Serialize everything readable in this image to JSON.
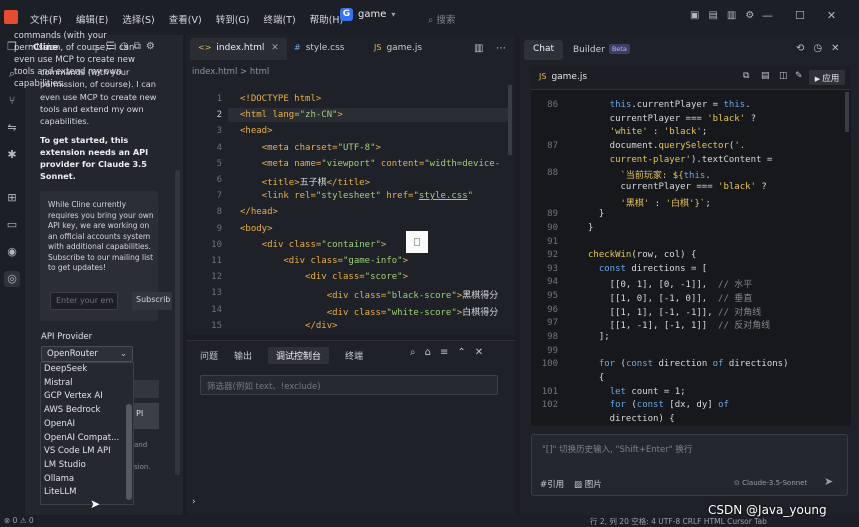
{
  "titlebar": {
    "menu": [
      "文件(F)",
      "编辑(E)",
      "选择(S)",
      "查看(V)",
      "转到(G)",
      "终端(T)",
      "帮助(H)"
    ],
    "project": "game",
    "project_icon": "G",
    "search_placeholder": "搜索"
  },
  "cline": {
    "title": "Cline",
    "intro": "commands (with your permission, of course). I can even use MCP to create new tools and extend my own capabilities.",
    "start": "To get started, this extension needs an API provider for Claude 3.5 Sonnet.",
    "info": "While Cline currently requires you bring your own API key, we are working on an official accounts system with additional capabilities. Subscribe to our mailing list to get updates!",
    "email_placeholder": "Enter your em",
    "subscribe": "Subscrib",
    "api_provider_label": "API Provider",
    "selected_provider": "OpenRouter",
    "providers": [
      "DeepSeek",
      "Mistral",
      "GCP Vertex AI",
      "AWS Bedrock",
      "OpenAI",
      "OpenAI Compat...",
      "VS Code LM API",
      "LM Studio",
      "Ollama",
      "LiteLLM"
    ],
    "behind_button": "PI",
    "behind_text_1": "and",
    "behind_text_2": "sion."
  },
  "editor": {
    "tabs": [
      {
        "label": "index.html",
        "icon": "<>"
      },
      {
        "label": "style.css",
        "icon": "#"
      },
      {
        "label": "game.js",
        "icon": "JS"
      }
    ],
    "breadcrumb": "index.html > html",
    "lines": [
      {
        "n": "1",
        "html": "<span class='tag'>&lt;!DOCTYPE html&gt;</span>"
      },
      {
        "n": "2",
        "html": "<span class='tag'>&lt;html</span> <span class='attr'>lang=</span><span class='str'>\"zh-CN\"</span><span class='tag'>&gt;</span>"
      },
      {
        "n": "3",
        "html": "<span class='tag'>&lt;head&gt;</span>"
      },
      {
        "n": "4",
        "html": "    <span class='tag'>&lt;meta</span> <span class='attr'>charset=</span><span class='str'>\"UTF-8\"</span><span class='tag'>&gt;</span>"
      },
      {
        "n": "5",
        "html": "    <span class='tag'>&lt;meta</span> <span class='attr'>name=</span><span class='str'>\"viewport\"</span> <span class='attr'>content=</span><span class='str'>\"width=device-</span>"
      },
      {
        "n": "6",
        "html": "    <span class='tag'>&lt;title&gt;</span><span class='txt'>五子棋</span><span class='tag'>&lt;/title&gt;</span>"
      },
      {
        "n": "7",
        "html": "    <span class='tag'>&lt;link</span> <span class='attr'>rel=</span><span class='str'>\"stylesheet\"</span> <span class='attr'>href=</span><span class='str'>\"<u>style.css</u>\"</span>"
      },
      {
        "n": "8",
        "html": "<span class='tag'>&lt;/head&gt;</span>"
      },
      {
        "n": "9",
        "html": "<span class='tag'>&lt;body&gt;</span>"
      },
      {
        "n": "10",
        "html": "    <span class='tag'>&lt;div</span> <span class='attr'>class=</span><span class='str'>\"container\"</span><span class='tag'>&gt;</span>"
      },
      {
        "n": "11",
        "html": "        <span class='tag'>&lt;div</span> <span class='attr'>class=</span><span class='str'>\"game-info\"</span><span class='tag'>&gt;</span>"
      },
      {
        "n": "12",
        "html": "            <span class='tag'>&lt;div</span> <span class='attr'>class=</span><span class='str'>\"score\"</span><span class='tag'>&gt;</span>"
      },
      {
        "n": "13",
        "html": "                <span class='tag'>&lt;div</span> <span class='attr'>class=</span><span class='str'>\"black-score\"</span><span class='tag'>&gt;</span><span class='txt'>黑棋得分</span>"
      },
      {
        "n": "14",
        "html": "                <span class='tag'>&lt;div</span> <span class='attr'>class=</span><span class='str'>\"white-score\"</span><span class='tag'>&gt;</span><span class='txt'>白棋得分</span>"
      },
      {
        "n": "15",
        "html": "            <span class='tag'>&lt;/div&gt;</span>"
      }
    ]
  },
  "panel": {
    "tabs": [
      "问题",
      "输出",
      "调试控制台",
      "终端"
    ],
    "active_tab": "调试控制台",
    "filter_placeholder": "筛选器(例如 text、!exclude)",
    "prompt": "›"
  },
  "chat": {
    "tabs": [
      "Chat",
      "Builder"
    ],
    "beta": "Beta",
    "file": "game.js",
    "apply": "应用",
    "lines": [
      {
        "n": "86",
        "html": "    <span class='kw'>this</span>.currentPlayer = <span class='kw'>this</span>."
      },
      {
        "n": "",
        "html": "    currentPlayer === <span class='rstr'>'black'</span> ?"
      },
      {
        "n": "",
        "html": "    <span class='rstr'>'white'</span> : <span class='rstr'>'black'</span>;"
      },
      {
        "n": "87",
        "html": "    document.<span class='fnm'>querySelector</span>(<span class='rstr'>'.</span>"
      },
      {
        "n": "",
        "html": "    <span class='rstr'>current-player'</span>).textContent ="
      },
      {
        "n": "88",
        "html": "      <span class='rstr'>`当前玩家: ${</span><span class='kw'>this</span>."
      },
      {
        "n": "",
        "html": "      currentPlayer === <span class='rstr'>'black'</span> ?"
      },
      {
        "n": "",
        "html": "      <span class='rstr'>'黑棋'</span> : <span class='rstr'>'白棋'</span><span class='rstr'>}`</span>;"
      },
      {
        "n": "89",
        "html": "  }"
      },
      {
        "n": "90",
        "html": "}"
      },
      {
        "n": "91",
        "html": ""
      },
      {
        "n": "92",
        "html": "<span class='fnm'>checkWin</span>(row, col) {"
      },
      {
        "n": "93",
        "html": "  <span class='kw'>const</span> directions = ["
      },
      {
        "n": "94",
        "html": "    [[0, 1], [0, -1]],  <span class='cm'>// 水平</span>"
      },
      {
        "n": "95",
        "html": "    [[1, 0], [-1, 0]],  <span class='cm'>// 垂直</span>"
      },
      {
        "n": "96",
        "html": "    [[1, 1], [-1, -1]], <span class='cm'>// 对角线</span>"
      },
      {
        "n": "97",
        "html": "    [[1, -1], [-1, 1]]  <span class='cm'>// 反对角线</span>"
      },
      {
        "n": "98",
        "html": "  ];"
      },
      {
        "n": "99",
        "html": ""
      },
      {
        "n": "100",
        "html": "  <span class='kw'>for</span> (<span class='kw'>const</span> direction <span class='kw'>of</span> directions)"
      },
      {
        "n": "",
        "html": "  {"
      },
      {
        "n": "101",
        "html": "    <span class='kw'>let</span> count = 1;"
      },
      {
        "n": "102",
        "html": "    <span class='kw'>for</span> (<span class='kw'>const</span> [dx, dy] <span class='kw'>of</span>"
      },
      {
        "n": "",
        "html": "    direction) {"
      }
    ],
    "input_placeholder": "\"[]\" 切换历史输入, \"Shift+Enter\" 换行",
    "ref_label": "#引用",
    "image_label": "图片",
    "model": "Claude-3.5-Sonnet"
  },
  "statusbar": {
    "left": "⊗ 0 ⚠ 0",
    "right": "行 2, 列 20   空格: 4   UTF-8   CRLF   HTML   Cursor Tab"
  },
  "watermark": "CSDN @Java_young"
}
